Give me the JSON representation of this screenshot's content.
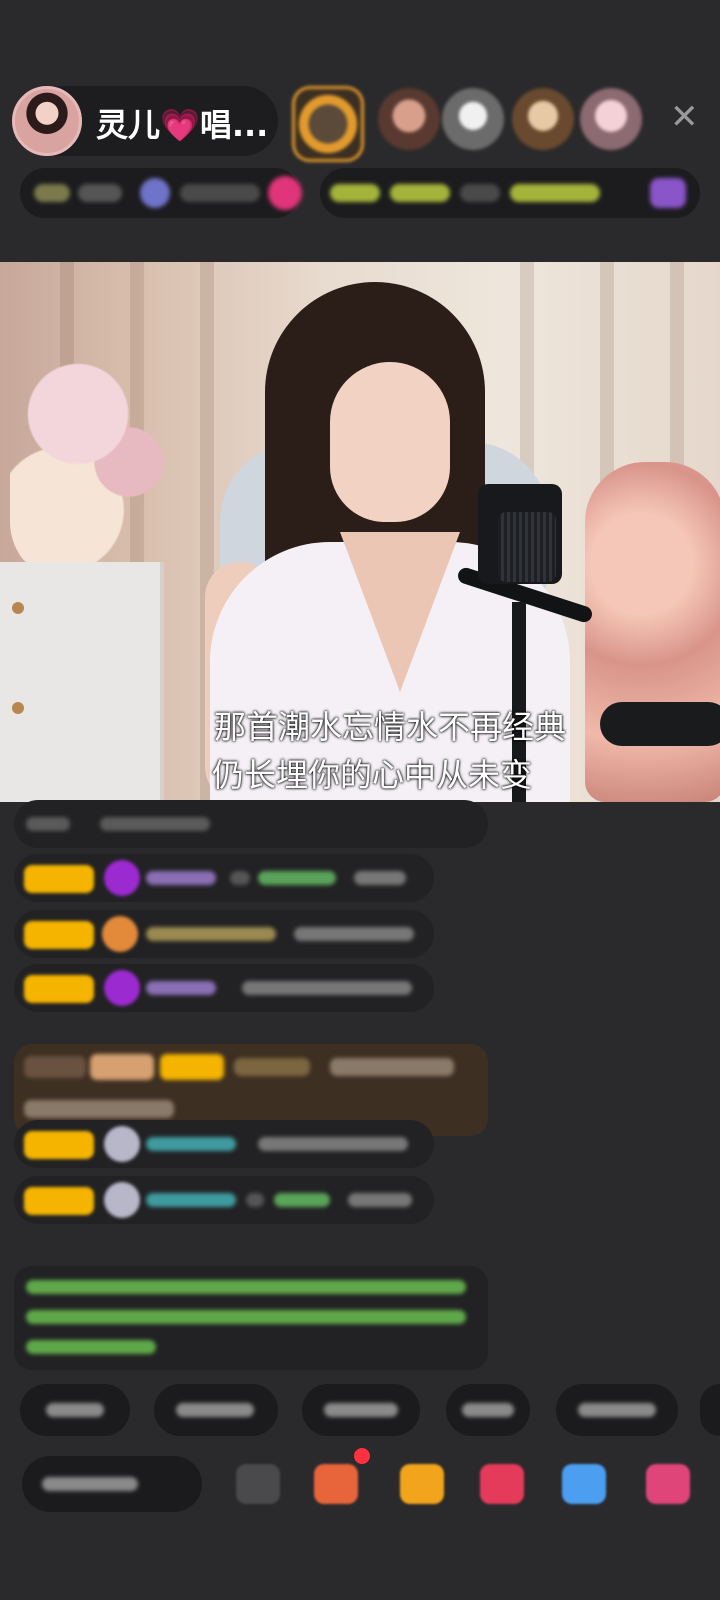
{
  "header": {
    "host_name": "灵儿💗唱...",
    "close_icon": "close-icon"
  },
  "video": {
    "subtitle_line1": "那首潮水忘情水不再经典",
    "subtitle_line2": "仍长埋你的心中从未变"
  },
  "colors": {
    "background": "#2a2a2c",
    "badge_gold": "#f4b400",
    "gift_message_bg": "#3d2f22",
    "welcome_text": "#7ed957",
    "notification_dot": "#ff3040"
  }
}
